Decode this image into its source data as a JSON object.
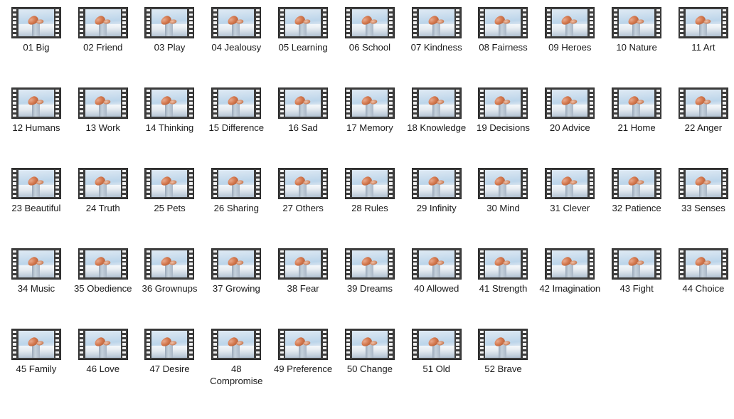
{
  "window": {
    "background_color": "#ffffff",
    "text_color": "#1b1b1b",
    "view": "large-icons",
    "item_count": 52
  },
  "icon": {
    "semantic_name": "film-strip-video-icon",
    "frame_color": "#3d3d3d",
    "sprocket_color": "#f2f2f2",
    "sky_color": "#cfe0ef",
    "pedestal_color": "#aab7c6",
    "subject_color": "#d4794f",
    "sprocket_count": 7
  },
  "grid": {
    "columns": 11,
    "rows": 5,
    "items": [
      {
        "number": "01",
        "name": "Big",
        "label": "01 Big"
      },
      {
        "number": "02",
        "name": "Friend",
        "label": "02 Friend"
      },
      {
        "number": "03",
        "name": "Play",
        "label": "03 Play"
      },
      {
        "number": "04",
        "name": "Jealousy",
        "label": "04 Jealousy"
      },
      {
        "number": "05",
        "name": "Learning",
        "label": "05 Learning"
      },
      {
        "number": "06",
        "name": "School",
        "label": "06 School"
      },
      {
        "number": "07",
        "name": "Kindness",
        "label": "07 Kindness"
      },
      {
        "number": "08",
        "name": "Fairness",
        "label": "08 Fairness"
      },
      {
        "number": "09",
        "name": "Heroes",
        "label": "09 Heroes"
      },
      {
        "number": "10",
        "name": "Nature",
        "label": "10 Nature"
      },
      {
        "number": "11",
        "name": "Art",
        "label": "11 Art"
      },
      {
        "number": "12",
        "name": "Humans",
        "label": "12 Humans"
      },
      {
        "number": "13",
        "name": "Work",
        "label": "13 Work"
      },
      {
        "number": "14",
        "name": "Thinking",
        "label": "14 Thinking"
      },
      {
        "number": "15",
        "name": "Difference",
        "label": "15 Difference"
      },
      {
        "number": "16",
        "name": "Sad",
        "label": "16 Sad"
      },
      {
        "number": "17",
        "name": "Memory",
        "label": "17 Memory"
      },
      {
        "number": "18",
        "name": "Knowledge",
        "label": "18 Knowledge"
      },
      {
        "number": "19",
        "name": "Decisions",
        "label": "19 Decisions"
      },
      {
        "number": "20",
        "name": "Advice",
        "label": "20 Advice"
      },
      {
        "number": "21",
        "name": "Home",
        "label": "21 Home"
      },
      {
        "number": "22",
        "name": "Anger",
        "label": "22 Anger"
      },
      {
        "number": "23",
        "name": "Beautiful",
        "label": "23 Beautiful"
      },
      {
        "number": "24",
        "name": "Truth",
        "label": "24 Truth"
      },
      {
        "number": "25",
        "name": "Pets",
        "label": "25 Pets"
      },
      {
        "number": "26",
        "name": "Sharing",
        "label": "26 Sharing"
      },
      {
        "number": "27",
        "name": "Others",
        "label": "27 Others"
      },
      {
        "number": "28",
        "name": "Rules",
        "label": "28 Rules"
      },
      {
        "number": "29",
        "name": "Infinity",
        "label": "29 Infinity"
      },
      {
        "number": "30",
        "name": "Mind",
        "label": "30 Mind"
      },
      {
        "number": "31",
        "name": "Clever",
        "label": "31 Clever"
      },
      {
        "number": "32",
        "name": "Patience",
        "label": "32 Patience"
      },
      {
        "number": "33",
        "name": "Senses",
        "label": "33 Senses"
      },
      {
        "number": "34",
        "name": "Music",
        "label": "34 Music"
      },
      {
        "number": "35",
        "name": "Obedience",
        "label": "35 Obedience"
      },
      {
        "number": "36",
        "name": "Grownups",
        "label": "36 Grownups"
      },
      {
        "number": "37",
        "name": "Growing",
        "label": "37 Growing"
      },
      {
        "number": "38",
        "name": "Fear",
        "label": "38 Fear"
      },
      {
        "number": "39",
        "name": "Dreams",
        "label": "39 Dreams"
      },
      {
        "number": "40",
        "name": "Allowed",
        "label": "40 Allowed"
      },
      {
        "number": "41",
        "name": "Strength",
        "label": "41 Strength"
      },
      {
        "number": "42",
        "name": "Imagination",
        "label": "42 Imagination"
      },
      {
        "number": "43",
        "name": "Fight",
        "label": "43 Fight"
      },
      {
        "number": "44",
        "name": "Choice",
        "label": "44 Choice"
      },
      {
        "number": "45",
        "name": "Family",
        "label": "45 Family"
      },
      {
        "number": "46",
        "name": "Love",
        "label": "46 Love"
      },
      {
        "number": "47",
        "name": "Desire",
        "label": "47 Desire"
      },
      {
        "number": "48",
        "name": "Compromise",
        "label": "48 Compromise"
      },
      {
        "number": "49",
        "name": "Preference",
        "label": "49 Preference"
      },
      {
        "number": "50",
        "name": "Change",
        "label": "50 Change"
      },
      {
        "number": "51",
        "name": "Old",
        "label": "51 Old"
      },
      {
        "number": "52",
        "name": "Brave",
        "label": "52 Brave"
      }
    ]
  }
}
